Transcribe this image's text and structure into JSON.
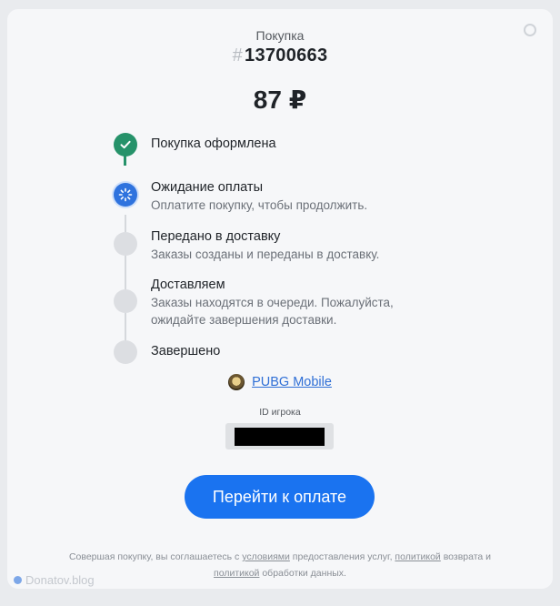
{
  "header": {
    "purchase_label": "Покупка",
    "order_hash": "#",
    "order_number": "13700663",
    "price": "87 ₽"
  },
  "steps": [
    {
      "title": "Покупка оформлена",
      "desc": "",
      "state": "done"
    },
    {
      "title": "Ожидание оплаты",
      "desc": "Оплатите покупку, чтобы продолжить.",
      "state": "active"
    },
    {
      "title": "Передано в доставку",
      "desc": "Заказы созданы и переданы в доставку.",
      "state": "pending"
    },
    {
      "title": "Доставляем",
      "desc": "Заказы находятся в очереди. Пожалуйста, ожидайте завершения доставки.",
      "state": "pending"
    },
    {
      "title": "Завершено",
      "desc": "",
      "state": "pending"
    }
  ],
  "game": {
    "name": "PUBG Mobile",
    "player_id_label": "ID игрока"
  },
  "pay_button_label": "Перейти к оплате",
  "legal": {
    "part1": "Совершая покупку, вы соглашаетесь с ",
    "link_terms": "условиями",
    "part2": " предоставления услуг, ",
    "link_refund": "политикой",
    "part3": " возврата и ",
    "link_privacy": "политикой",
    "part4": " обработки данных."
  },
  "watermark": "Donatov.blog",
  "colors": {
    "done": "#26926a",
    "active": "#2f73de",
    "pending": "#dcdee2",
    "button": "#1a73f0",
    "link": "#2f6fd6"
  }
}
